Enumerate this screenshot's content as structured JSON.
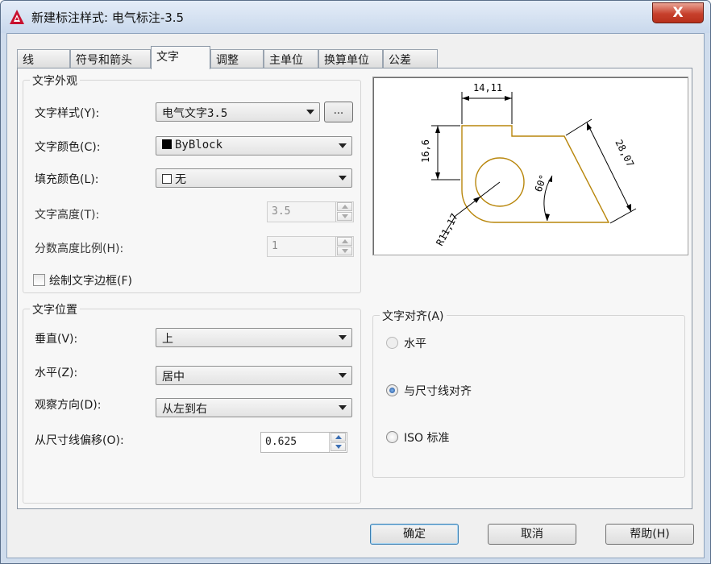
{
  "window": {
    "title": "新建标注样式: 电气标注-3.5",
    "close_label": "X"
  },
  "tabs": [
    {
      "label": "线"
    },
    {
      "label": "符号和箭头"
    },
    {
      "label": "文字"
    },
    {
      "label": "调整"
    },
    {
      "label": "主单位"
    },
    {
      "label": "换算单位"
    },
    {
      "label": "公差"
    }
  ],
  "text_appearance": {
    "title": "文字外观",
    "style_label": "文字样式(Y):",
    "style_value": "电气文字3.5",
    "style_button": "...",
    "color_label": "文字颜色(C):",
    "color_value": "ByBlock",
    "fill_label": "填充颜色(L):",
    "fill_value": "无",
    "height_label": "文字高度(T):",
    "height_value": "3.5",
    "fraction_label": "分数高度比例(H):",
    "fraction_value": "1",
    "frame_label": "绘制文字边框(F)"
  },
  "text_position": {
    "title": "文字位置",
    "vertical_label": "垂直(V):",
    "vertical_value": "上",
    "horizontal_label": "水平(Z):",
    "horizontal_value": "居中",
    "direction_label": "观察方向(D):",
    "direction_value": "从左到右",
    "offset_label": "从尺寸线偏移(O):",
    "offset_value": "0.625"
  },
  "text_alignment": {
    "title": "文字对齐(A)",
    "options": [
      {
        "label": "水平"
      },
      {
        "label": "与尺寸线对齐"
      },
      {
        "label": "ISO 标准"
      }
    ]
  },
  "preview": {
    "dim_top": "14,11",
    "dim_left": "16,6",
    "dim_slant": "28,07",
    "dim_angle": "60°",
    "dim_radius": "R11,17"
  },
  "buttons": {
    "ok": "确定",
    "cancel": "取消",
    "help": "帮助(H)"
  },
  "colors": {
    "drawing_outline": "#b8860b",
    "dimension_lines": "#000000"
  }
}
